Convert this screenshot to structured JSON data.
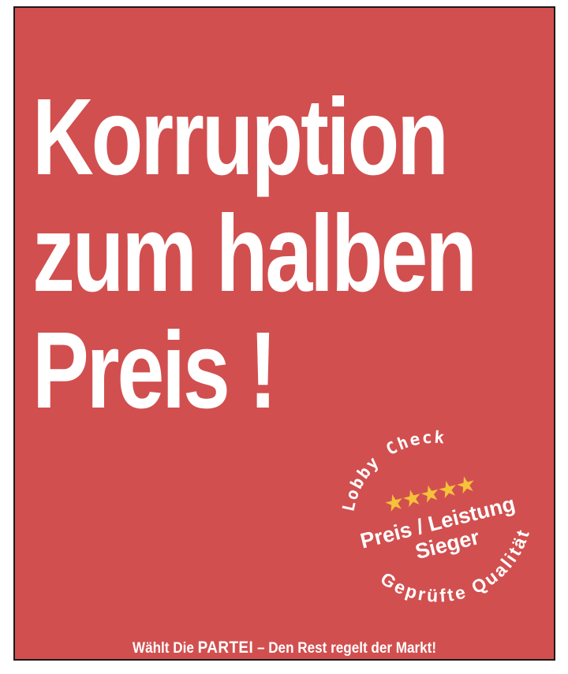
{
  "headline": {
    "line1": "Korruption",
    "line2": "zum halben",
    "line3": "Preis !"
  },
  "seal": {
    "arc_top": "Lobby Check",
    "stars": "★★★★★",
    "star_count": 5,
    "line1": "Preis / Leistung",
    "line2": "Sieger",
    "arc_bottom": "Geprüfte Qualität",
    "star_color": "#f5c23a"
  },
  "footer": {
    "prefix": "Wählt Die ",
    "brand": "PARTEI",
    "suffix": " – Den Rest regelt der Markt!"
  },
  "colors": {
    "background": "#d24f4f",
    "text": "#ffffff",
    "border": "#1a1a1a"
  }
}
